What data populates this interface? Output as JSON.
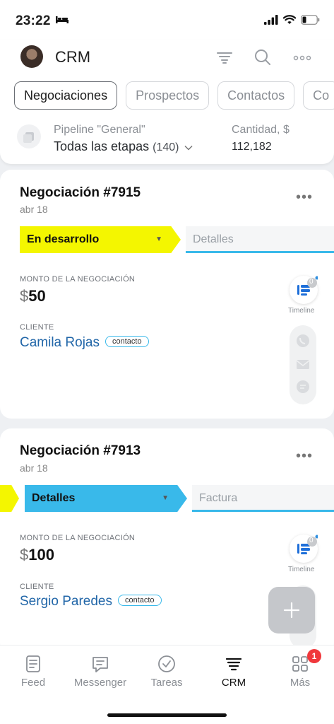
{
  "status": {
    "time": "23:22"
  },
  "header": {
    "title": "CRM",
    "tabs": [
      "Negociaciones",
      "Prospectos",
      "Contactos",
      "Co"
    ],
    "pipeline_label": "Pipeline \"General\"",
    "pipeline_value": "Todas las etapas",
    "pipeline_count": "(140)",
    "amount_label": "Cantidad, $",
    "amount_value": "112,182"
  },
  "deals": [
    {
      "title": "Negociación #7915",
      "date": "abr 18",
      "stage": "En desarrollo",
      "next_stage": "Detalles",
      "amount_label": "MONTO DE LA NEGOCIACIÓN",
      "currency": "$",
      "amount": "50",
      "client_label": "CLIENTE",
      "client": "Camila Rojas",
      "client_type": "contacto",
      "timeline_label": "Timeline",
      "timeline_count": "0",
      "colors": {
        "stage": "#f4f600"
      }
    },
    {
      "title": "Negociación #7913",
      "date": "abr 18",
      "stage": "Detalles",
      "next_stage": "Factura",
      "amount_label": "MONTO DE LA NEGOCIACIÓN",
      "currency": "$",
      "amount": "100",
      "client_label": "CLIENTE",
      "client": "Sergio Paredes",
      "client_type": "contacto",
      "timeline_label": "Timeline",
      "timeline_count": "0",
      "colors": {
        "stage": "#39b9ea"
      }
    }
  ],
  "nav": {
    "items": [
      "Feed",
      "Messenger",
      "Tareas",
      "CRM",
      "Más"
    ],
    "active": "CRM",
    "badge": "1"
  },
  "icons": [
    "bed-icon",
    "signal-icon",
    "wifi-icon",
    "battery-icon",
    "filter-icon",
    "search-icon",
    "more-icon",
    "plus-icon"
  ]
}
